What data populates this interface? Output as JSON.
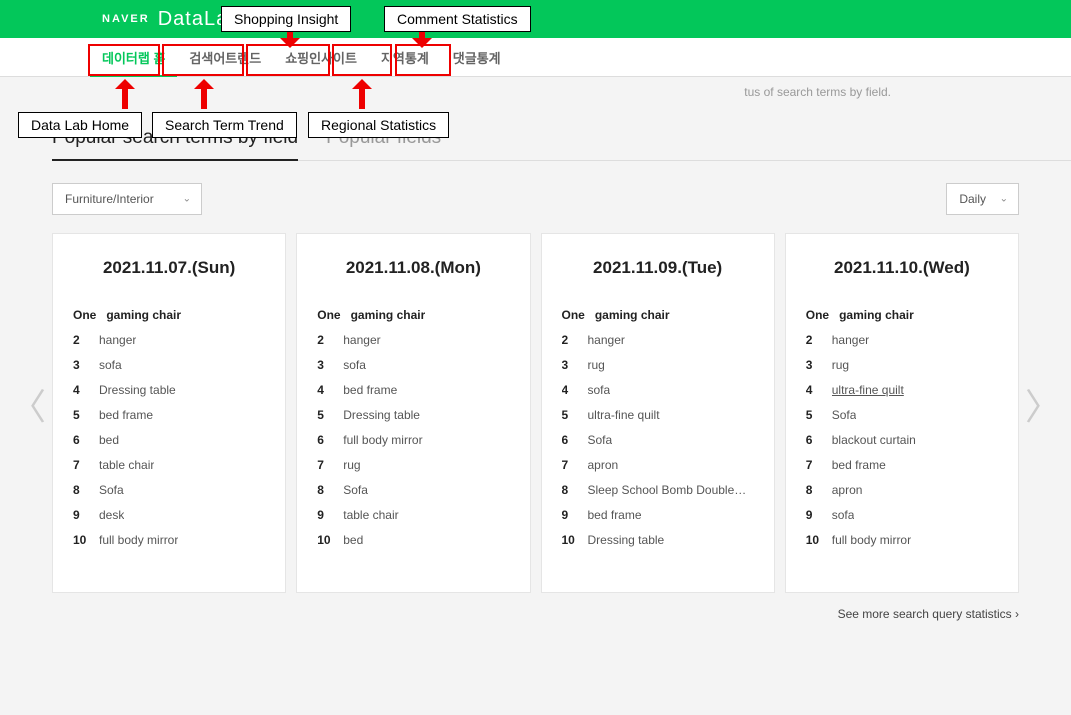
{
  "brand": {
    "naver": "NAVER",
    "datalab": "DataLab."
  },
  "nav": {
    "items": [
      {
        "label": "데이터랩 홈"
      },
      {
        "label": "검색어트렌드"
      },
      {
        "label": "쇼핑인사이트"
      },
      {
        "label": "지역통계"
      },
      {
        "label": "댓글통계"
      }
    ]
  },
  "annotations": {
    "shopping": "Shopping Insight",
    "comment": "Comment Statistics",
    "home": "Data Lab Home",
    "search": "Search Term Trend",
    "regional": "Regional Statistics"
  },
  "subtitle_tail": "tus of search terms by field.",
  "tabs": {
    "popular_terms": "Popular search terms by field",
    "popular_fields": "Popular fields"
  },
  "filter": {
    "category": "Furniture/Interior",
    "period": "Daily"
  },
  "rank_one_label": "One",
  "cards": [
    {
      "date": "2021.11.07.(Sun)",
      "items": [
        "gaming chair",
        "hanger",
        "sofa",
        "Dressing table",
        "bed frame",
        "bed",
        "table chair",
        "Sofa",
        "desk",
        "full body mirror"
      ]
    },
    {
      "date": "2021.11.08.(Mon)",
      "items": [
        "gaming chair",
        "hanger",
        "sofa",
        "bed frame",
        "Dressing table",
        "full body mirror",
        "rug",
        "Sofa",
        "table chair",
        "bed"
      ]
    },
    {
      "date": "2021.11.09.(Tue)",
      "items": [
        "gaming chair",
        "hanger",
        "rug",
        "sofa",
        "ultra-fine quilt",
        "Sofa",
        "apron",
        "Sleep School Bomb Double…",
        "bed frame",
        "Dressing table"
      ]
    },
    {
      "date": "2021.11.10.(Wed)",
      "items": [
        "gaming chair",
        "hanger",
        "rug",
        "ultra-fine quilt",
        "Sofa",
        "blackout curtain",
        "bed frame",
        "apron",
        "sofa",
        "full body mirror"
      ],
      "underline_index": 3
    }
  ],
  "see_more": "See more search query statistics"
}
